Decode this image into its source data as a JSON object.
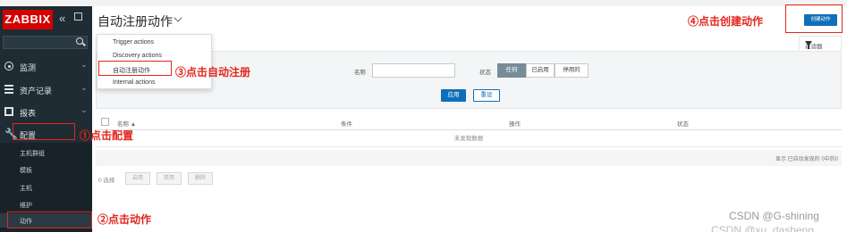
{
  "sidebar": {
    "logo": "ZABBIX",
    "collapse_glyph": "«",
    "menu": [
      {
        "label": "监测"
      },
      {
        "label": "资产记录"
      },
      {
        "label": "报表"
      },
      {
        "label": "配置"
      }
    ],
    "submenu": [
      {
        "label": "主机群组"
      },
      {
        "label": "模板"
      },
      {
        "label": "主机"
      },
      {
        "label": "维护"
      },
      {
        "label": "动作"
      }
    ]
  },
  "header": {
    "title": "自动注册动作",
    "create_button": "创建动作",
    "filter_tab": "过滤器"
  },
  "dropdown": {
    "items": [
      {
        "label": "Trigger actions"
      },
      {
        "label": "Discovery actions"
      },
      {
        "label": "自动注册动作"
      },
      {
        "label": "Internal actions"
      }
    ]
  },
  "filter": {
    "name_label": "名称",
    "name_value": "",
    "status_label": "状态",
    "status_options": [
      {
        "label": "任何",
        "active": true
      },
      {
        "label": "已启用",
        "active": false
      },
      {
        "label": "停用的",
        "active": false
      }
    ],
    "apply_button": "应用",
    "reset_button": "重设"
  },
  "table": {
    "columns": [
      "名称 ▲",
      "条件",
      "操作",
      "状态"
    ],
    "no_data": "未发现数据",
    "summary": "显示 已自动发现的 0中的0"
  },
  "bottom": {
    "selected": "0 选择",
    "buttons": [
      "启用",
      "禁用",
      "删除"
    ]
  },
  "annotations": {
    "a1": "①点击配置",
    "a2": "②点击动作",
    "a3": "③点击自动注册",
    "a4": "④点击创建动作",
    "annotation_color": "#e2261c"
  },
  "watermark": {
    "line1": "CSDN @G-shining",
    "line2": "CSDN @xu_dasheng"
  },
  "colors": {
    "sidebar_bg": "#1f2c33",
    "logo_red": "#d40000",
    "primary_blue": "#0f6fba"
  }
}
